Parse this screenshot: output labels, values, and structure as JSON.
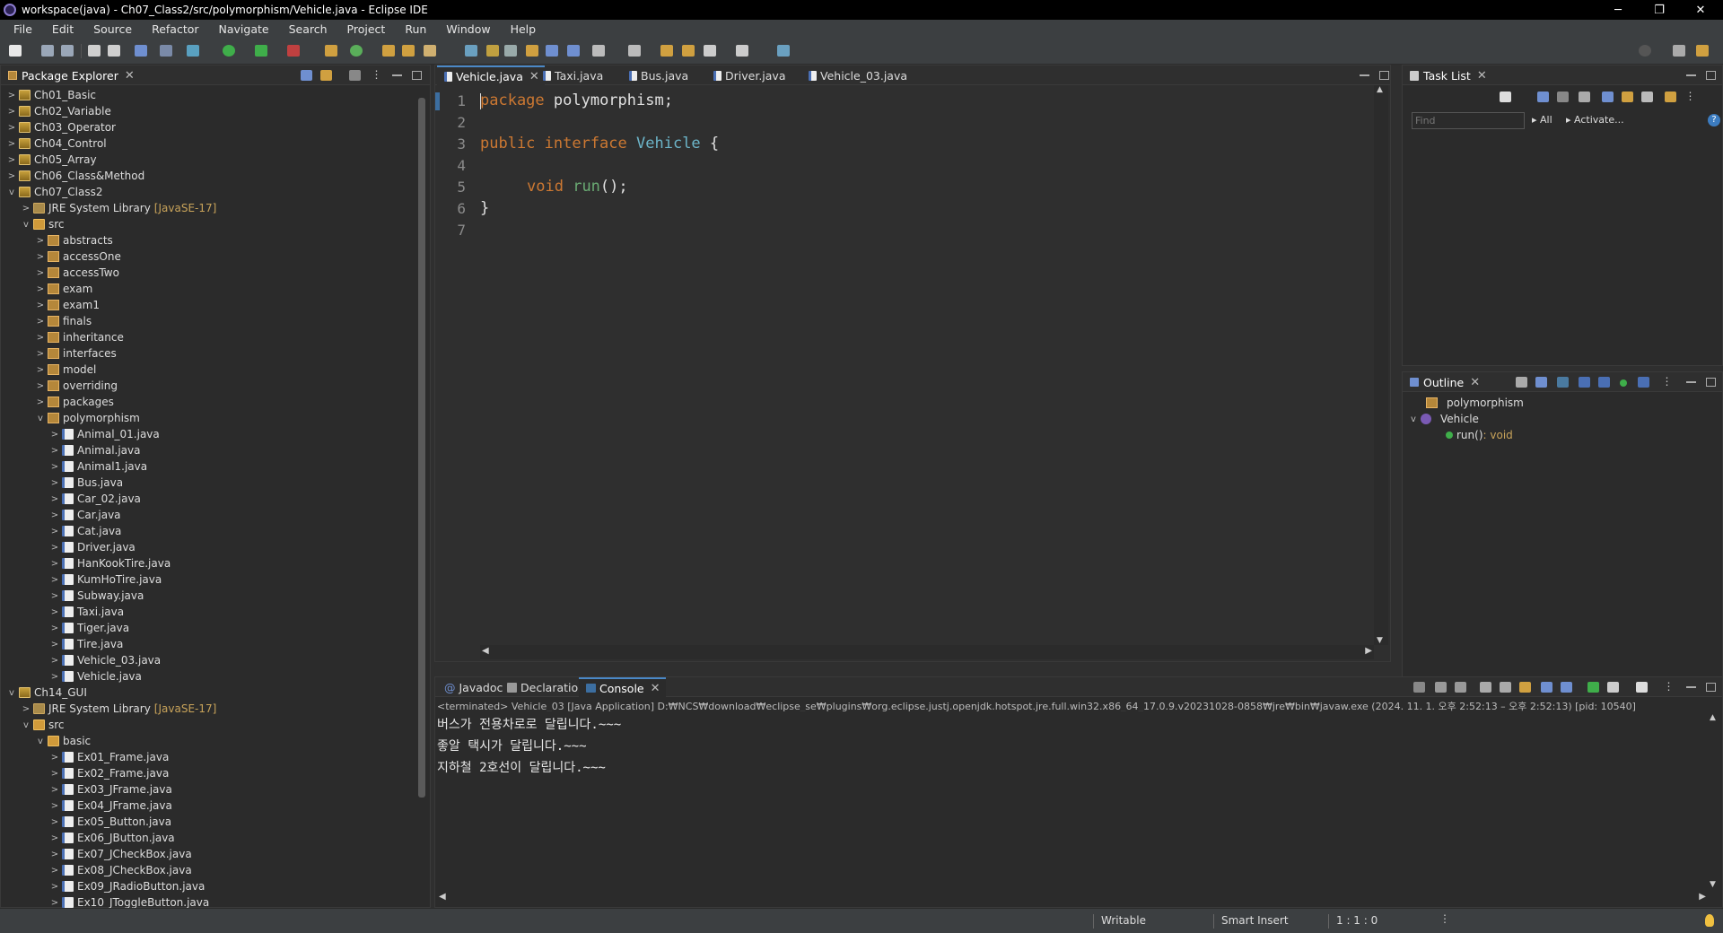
{
  "window": {
    "title": "workspace(java) - Ch07_Class2/src/polymorphism/Vehicle.java - Eclipse IDE",
    "minimize": "─",
    "restore": "❐",
    "close": "✕"
  },
  "menu": [
    "File",
    "Edit",
    "Source",
    "Refactor",
    "Navigate",
    "Search",
    "Project",
    "Run",
    "Window",
    "Help"
  ],
  "package_explorer": {
    "title": "Package Explorer",
    "items": [
      {
        "label": "Ch01_Basic",
        "level": 0,
        "icon": "proj",
        "arrow": ">"
      },
      {
        "label": "Ch02_Variable",
        "level": 0,
        "icon": "proj",
        "arrow": ">"
      },
      {
        "label": "Ch03_Operator",
        "level": 0,
        "icon": "proj",
        "arrow": ">"
      },
      {
        "label": "Ch04_Control",
        "level": 0,
        "icon": "proj",
        "arrow": ">"
      },
      {
        "label": "Ch05_Array",
        "level": 0,
        "icon": "proj",
        "arrow": ">"
      },
      {
        "label": "Ch06_Class&Method",
        "level": 0,
        "icon": "proj",
        "arrow": ">"
      },
      {
        "label": "Ch07_Class2",
        "level": 0,
        "icon": "proj",
        "arrow": "v"
      },
      {
        "label": "JRE System Library",
        "extra": "[JavaSE-17]",
        "level": 1,
        "icon": "lib",
        "arrow": ">"
      },
      {
        "label": "src",
        "level": 1,
        "icon": "src",
        "arrow": "v"
      },
      {
        "label": "abstracts",
        "level": 2,
        "icon": "pkg",
        "arrow": ">"
      },
      {
        "label": "accessOne",
        "level": 2,
        "icon": "pkg",
        "arrow": ">"
      },
      {
        "label": "accessTwo",
        "level": 2,
        "icon": "pkg",
        "arrow": ">"
      },
      {
        "label": "exam",
        "level": 2,
        "icon": "pkg",
        "arrow": ">"
      },
      {
        "label": "exam1",
        "level": 2,
        "icon": "pkg",
        "arrow": ">"
      },
      {
        "label": "finals",
        "level": 2,
        "icon": "pkg",
        "arrow": ">"
      },
      {
        "label": "inheritance",
        "level": 2,
        "icon": "pkg",
        "arrow": ">"
      },
      {
        "label": "interfaces",
        "level": 2,
        "icon": "pkg",
        "arrow": ">"
      },
      {
        "label": "model",
        "level": 2,
        "icon": "pkg",
        "arrow": ">"
      },
      {
        "label": "overriding",
        "level": 2,
        "icon": "pkg",
        "arrow": ">"
      },
      {
        "label": "packages",
        "level": 2,
        "icon": "pkg",
        "arrow": ">"
      },
      {
        "label": "polymorphism",
        "level": 2,
        "icon": "pkg",
        "arrow": "v"
      },
      {
        "label": "Animal_01.java",
        "level": 3,
        "icon": "file",
        "arrow": ">"
      },
      {
        "label": "Animal.java",
        "level": 3,
        "icon": "file",
        "arrow": ">"
      },
      {
        "label": "Animal1.java",
        "level": 3,
        "icon": "file",
        "arrow": ">"
      },
      {
        "label": "Bus.java",
        "level": 3,
        "icon": "file",
        "arrow": ">"
      },
      {
        "label": "Car_02.java",
        "level": 3,
        "icon": "file",
        "arrow": ">"
      },
      {
        "label": "Car.java",
        "level": 3,
        "icon": "file",
        "arrow": ">"
      },
      {
        "label": "Cat.java",
        "level": 3,
        "icon": "file",
        "arrow": ">"
      },
      {
        "label": "Driver.java",
        "level": 3,
        "icon": "file",
        "arrow": ">"
      },
      {
        "label": "HanKookTire.java",
        "level": 3,
        "icon": "file",
        "arrow": ">"
      },
      {
        "label": "KumHoTire.java",
        "level": 3,
        "icon": "file",
        "arrow": ">"
      },
      {
        "label": "Subway.java",
        "level": 3,
        "icon": "file",
        "arrow": ">"
      },
      {
        "label": "Taxi.java",
        "level": 3,
        "icon": "file",
        "arrow": ">"
      },
      {
        "label": "Tiger.java",
        "level": 3,
        "icon": "file",
        "arrow": ">"
      },
      {
        "label": "Tire.java",
        "level": 3,
        "icon": "file",
        "arrow": ">"
      },
      {
        "label": "Vehicle_03.java",
        "level": 3,
        "icon": "file",
        "arrow": ">"
      },
      {
        "label": "Vehicle.java",
        "level": 3,
        "icon": "file",
        "arrow": ">"
      },
      {
        "label": "Ch14_GUI",
        "level": 0,
        "icon": "proj",
        "arrow": "v"
      },
      {
        "label": "JRE System Library",
        "extra": "[JavaSE-17]",
        "level": 1,
        "icon": "lib",
        "arrow": ">"
      },
      {
        "label": "src",
        "level": 1,
        "icon": "src",
        "arrow": "v"
      },
      {
        "label": "basic",
        "level": 2,
        "icon": "src",
        "arrow": "v"
      },
      {
        "label": "Ex01_Frame.java",
        "level": 3,
        "icon": "file",
        "arrow": ">"
      },
      {
        "label": "Ex02_Frame.java",
        "level": 3,
        "icon": "file",
        "arrow": ">"
      },
      {
        "label": "Ex03_JFrame.java",
        "level": 3,
        "icon": "file",
        "arrow": ">"
      },
      {
        "label": "Ex04_JFrame.java",
        "level": 3,
        "icon": "file",
        "arrow": ">"
      },
      {
        "label": "Ex05_Button.java",
        "level": 3,
        "icon": "file",
        "arrow": ">"
      },
      {
        "label": "Ex06_JButton.java",
        "level": 3,
        "icon": "file",
        "arrow": ">"
      },
      {
        "label": "Ex07_JCheckBox.java",
        "level": 3,
        "icon": "file",
        "arrow": ">"
      },
      {
        "label": "Ex08_JCheckBox.java",
        "level": 3,
        "icon": "file",
        "arrow": ">"
      },
      {
        "label": "Ex09_JRadioButton.java",
        "level": 3,
        "icon": "file",
        "arrow": ">"
      },
      {
        "label": "Ex10_JToggleButton.java",
        "level": 3,
        "icon": "file",
        "arrow": ">"
      }
    ]
  },
  "editor": {
    "tabs": [
      "Vehicle.java",
      "Taxi.java",
      "Bus.java",
      "Driver.java",
      "Vehicle_03.java"
    ],
    "line_numbers": [
      "1",
      "2",
      "3",
      "4",
      "5",
      "6",
      "7"
    ],
    "code": {
      "l1_kw": "package",
      "l1_rest": " polymorphism;",
      "l3_kw": "public interface",
      "l3_type": "Vehicle",
      "l3_rest": " {",
      "l5_kw": "void",
      "l5_method": "run",
      "l5_rest": "();",
      "l6": "}"
    }
  },
  "task_list": {
    "title": "Task List",
    "find_placeholder": "Find",
    "all": "All",
    "activate": "Activate..."
  },
  "outline": {
    "title": "Outline",
    "package": "polymorphism",
    "type": "Vehicle",
    "method": "run()",
    "method_type": " : void"
  },
  "bottom_tabs": [
    "Javadoc",
    "Declaration",
    "Console"
  ],
  "console": {
    "header": "<terminated> Vehicle_03 [Java Application] D:₩NCS₩download₩eclipse_se₩plugins₩org.eclipse.justj.openjdk.hotspot.jre.full.win32.x86_64_17.0.9.v20231028-0858₩jre₩bin₩javaw.exe  (2024. 11. 1. 오후 2:52:13 – 오후 2:52:13) [pid: 10540]",
    "lines": [
      "버스가 전용차로로 달립니다.~~~",
      "좋알 택시가 달립니다.~~~",
      "지하철 2호선이 달립니다.~~~"
    ]
  },
  "status": {
    "writable": "Writable",
    "insert": "Smart Insert",
    "position": "1 : 1 : 0"
  },
  "colors": {
    "keyword": "#cc7832",
    "type": "#6cb4c8",
    "method": "#6aab73",
    "background": "#2f2f2f"
  }
}
